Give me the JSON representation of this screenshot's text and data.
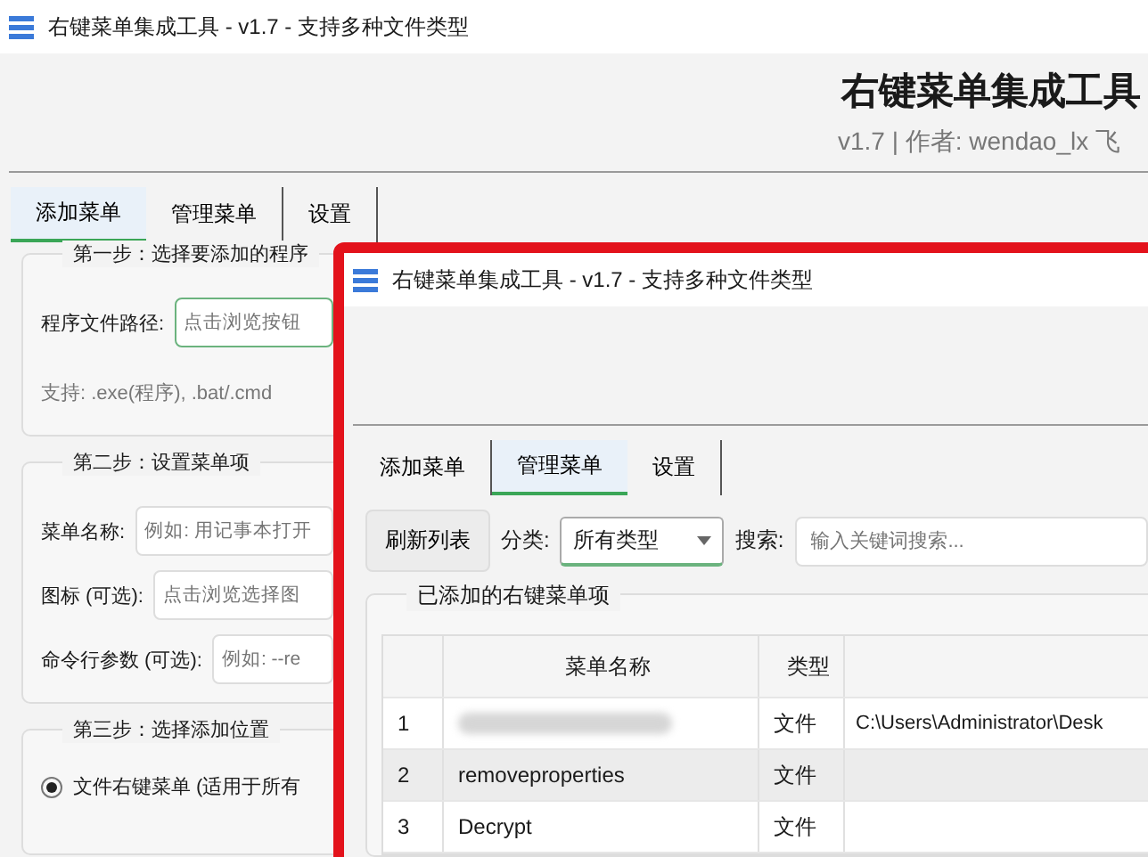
{
  "window": {
    "title": "右键菜单集成工具 - v1.7 - 支持多种文件类型"
  },
  "header": {
    "title": "右键菜单集成工具",
    "subtitle": "v1.7 | 作者: wendao_lx 飞"
  },
  "tabs": [
    {
      "label": "添加菜单",
      "selected": true
    },
    {
      "label": "管理菜单",
      "selected": false
    },
    {
      "label": "设置",
      "selected": false
    }
  ],
  "step1": {
    "title": "第一步：选择要添加的程序",
    "path_label": "程序文件路径:",
    "path_placeholder": "点击浏览按钮",
    "note": "支持: .exe(程序), .bat/.cmd"
  },
  "step2": {
    "title": "第二步：设置菜单项",
    "fields": [
      {
        "label": "菜单名称:",
        "placeholder": "例如: 用记事本打开"
      },
      {
        "label": "图标 (可选):",
        "placeholder": "点击浏览选择图"
      },
      {
        "label": "命令行参数 (可选):",
        "placeholder": "例如: --re"
      }
    ]
  },
  "step3": {
    "title": "第三步：选择添加位置",
    "options": [
      {
        "label": "文件右键菜单 (适用于所有",
        "selected": true
      }
    ]
  },
  "overlay_window": {
    "title": "右键菜单集成工具 - v1.7 - 支持多种文件类型",
    "tabs": [
      {
        "label": "添加菜单",
        "selected": false
      },
      {
        "label": "管理菜单",
        "selected": true
      },
      {
        "label": "设置",
        "selected": false
      }
    ],
    "refresh_button": "刷新列表",
    "category_label": "分类:",
    "category_value": "所有类型",
    "search_label": "搜索:",
    "search_placeholder": "输入关键词搜索...",
    "group_title": "已添加的右键菜单项",
    "table": {
      "columns": [
        "菜单名称",
        "类型"
      ],
      "rows": [
        {
          "index": "1",
          "redacted": true,
          "type": "文件",
          "path": "C:\\Users\\Administrator\\Desk",
          "selected": false
        },
        {
          "index": "2",
          "redacted": false,
          "name": "removeproperties",
          "type": "文件",
          "selected": true
        },
        {
          "index": "3",
          "redacted": false,
          "name": "Decrypt",
          "type": "文件",
          "selected": false
        }
      ]
    }
  }
}
